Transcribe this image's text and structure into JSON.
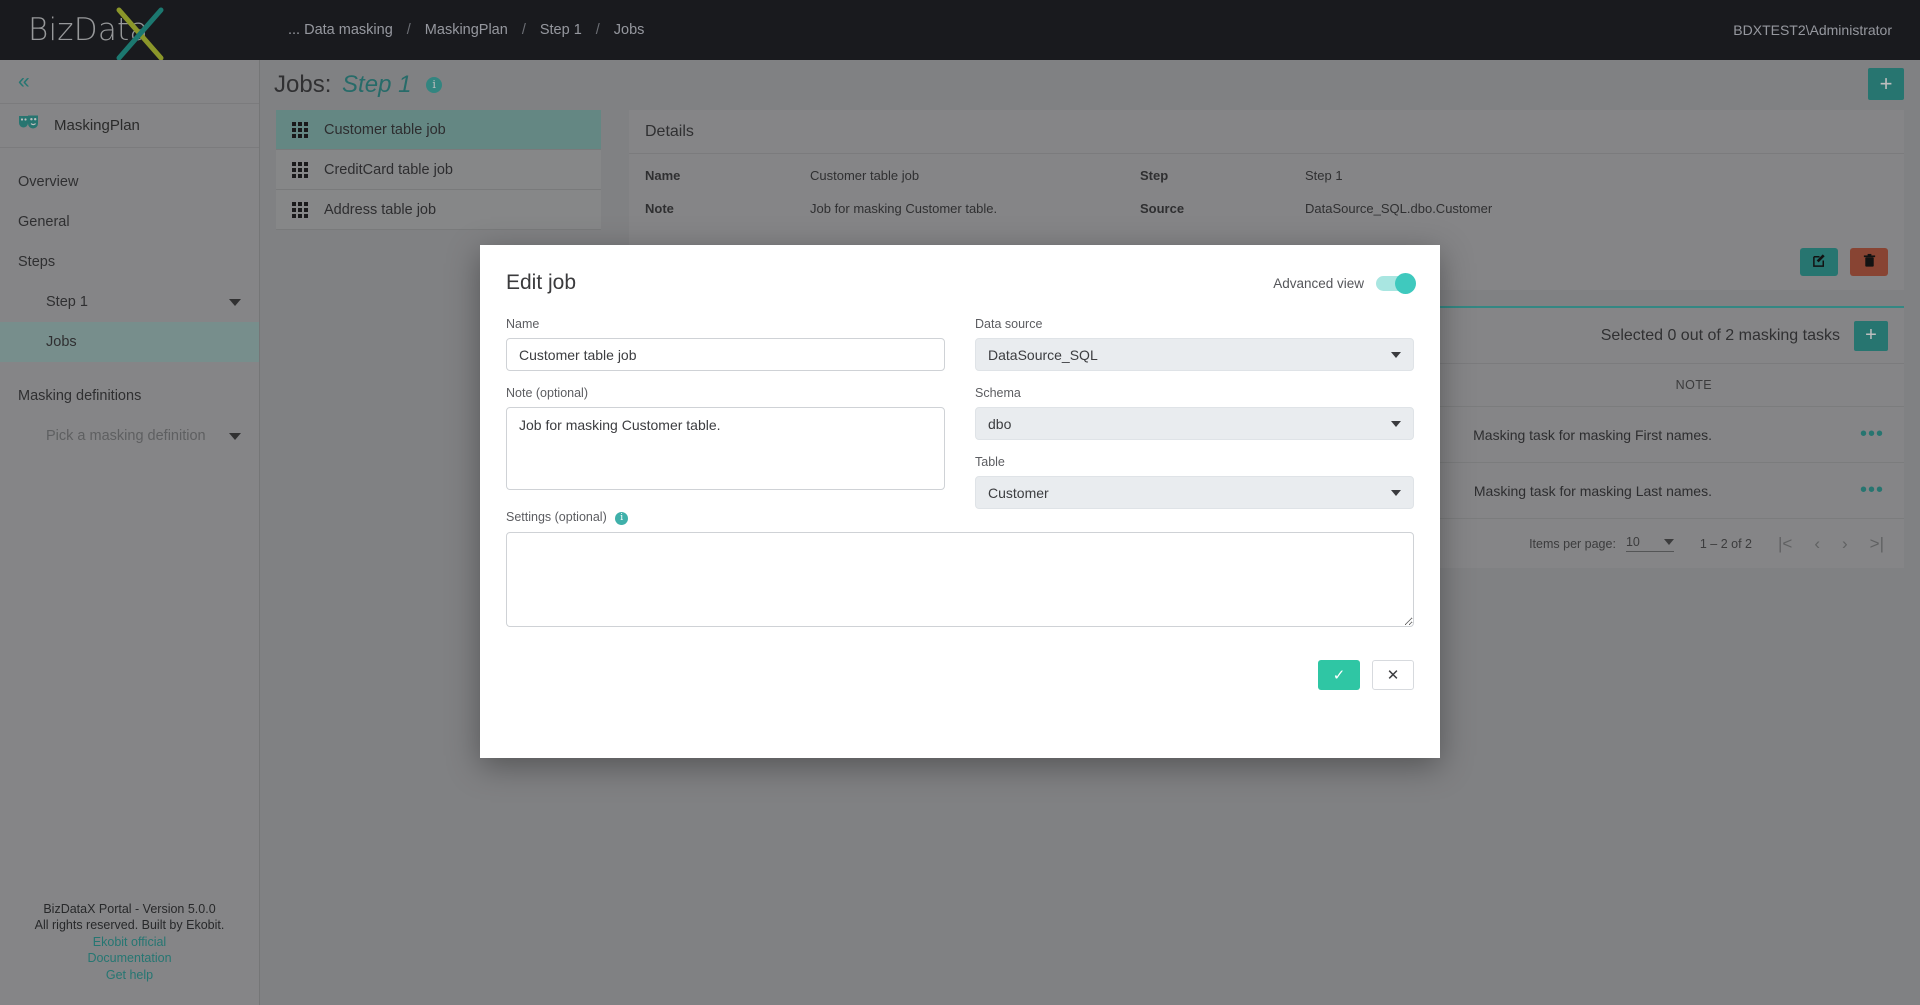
{
  "topbar": {
    "logo_text": "BizData",
    "logo_x_icon": "logo-x-icon",
    "breadcrumb": [
      {
        "label": "... Data masking"
      },
      {
        "label": "MaskingPlan"
      },
      {
        "label": "Step 1"
      },
      {
        "label": "Jobs"
      }
    ],
    "separator": "/",
    "user": "BDXTEST2\\Administrator"
  },
  "sidebar": {
    "collapse_icon": "chevron-double-left-icon",
    "plan": {
      "icon": "theater-masks-icon",
      "label": "MaskingPlan"
    },
    "items": [
      {
        "label": "Overview"
      },
      {
        "label": "General"
      },
      {
        "label": "Steps"
      },
      {
        "label": "Step 1"
      },
      {
        "label": "Jobs"
      },
      {
        "label": "Masking definitions"
      },
      {
        "label": "Pick a masking definition"
      }
    ],
    "footer": {
      "version": "BizDataX Portal - Version 5.0.0",
      "rights": "All rights reserved. Built by Ekobit.",
      "links": [
        {
          "label": "Ekobit official"
        },
        {
          "label": "Documentation"
        },
        {
          "label": "Get help"
        }
      ]
    }
  },
  "page": {
    "title_prefix": "Jobs:",
    "title_step": "Step 1",
    "info_glyph": "i",
    "add_label": "+"
  },
  "jobs": [
    {
      "label": "Customer table job"
    },
    {
      "label": "CreditCard table job"
    },
    {
      "label": "Address table job"
    }
  ],
  "details": {
    "heading": "Details",
    "rows": [
      {
        "label_left": "Name",
        "value_left": "Customer table job",
        "label_right": "Step",
        "value_right": "Step 1"
      },
      {
        "label_left": "Note",
        "value_left": "Job for masking Customer table.",
        "label_right": "Source",
        "value_right": "DataSource_SQL.dbo.Customer"
      }
    ],
    "edit_icon": "edit-pencil-icon",
    "delete_icon": "trash-icon"
  },
  "tasks": {
    "selected_text": "Selected 0 out of 2 masking tasks",
    "add_label": "+",
    "columns": [
      "NOTE"
    ],
    "rows": [
      {
        "note": "Masking task for masking First names.",
        "menu_icon": "more-options-icon"
      },
      {
        "note": "Masking task for masking Last names.",
        "menu_icon": "more-options-icon"
      }
    ],
    "paginator": {
      "items_per_page_label": "Items per page:",
      "items_per_page_value": "10",
      "range_label": "1 – 2 of 2",
      "first_icon": "|<",
      "prev_icon": "‹",
      "next_icon": "›",
      "last_icon": ">|"
    }
  },
  "modal": {
    "title": "Edit job",
    "advanced_view_label": "Advanced view",
    "advanced_view_on": true,
    "fields": {
      "name_label": "Name",
      "name_value": "Customer table job",
      "name_placeholder": "Name",
      "note_label": "Note (optional)",
      "note_value": "Job for masking Customer table.",
      "note_placeholder": "Note (optional)",
      "settings_label": "Settings (optional)",
      "settings_value": "",
      "settings_placeholder": "",
      "datasource_label": "Data source",
      "datasource_value": "DataSource_SQL",
      "schema_label": "Schema",
      "schema_value": "dbo",
      "table_label": "Table",
      "table_value": "Customer"
    },
    "confirm_label": "✓",
    "cancel_label": "✕"
  },
  "colors": {
    "teal": "#2f9a94",
    "teal_light": "#3fc9be",
    "danger": "#b5573f",
    "dark": "#1b1d22",
    "sidebar": "#b0b1b3"
  }
}
